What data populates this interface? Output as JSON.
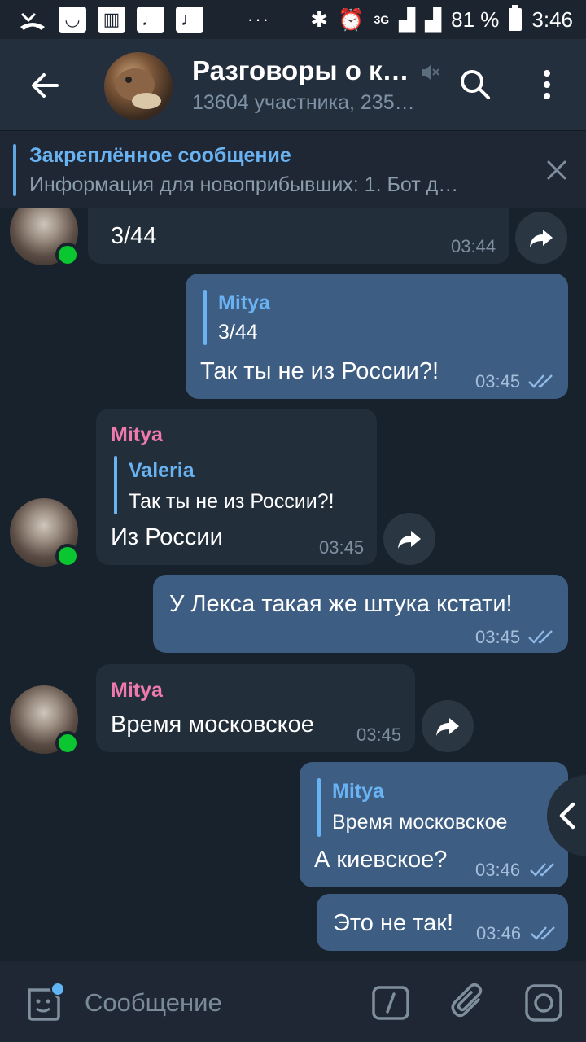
{
  "status_bar": {
    "signal_label": "3G",
    "battery": "81 %",
    "time": "3:46"
  },
  "header": {
    "title": "Разговоры о к…",
    "subtitle": "13604 участника, 235…"
  },
  "pinned": {
    "title": "Закреплённое сообщение",
    "text": "Информация для новоприбывших:  1. Бот д…"
  },
  "messages": [
    {
      "dir": "in",
      "text": "3/44",
      "time": "03:44"
    },
    {
      "dir": "out",
      "reply_name": "Mitya",
      "reply_text": "3/44",
      "text": "Так ты не из России?!",
      "time": "03:45"
    },
    {
      "dir": "in",
      "sender": "Mitya",
      "reply_name": "Valeria",
      "reply_text": "Так ты не из России?!",
      "text": "Из России",
      "time": "03:45"
    },
    {
      "dir": "out",
      "text": "У Лекса такая же штука кстати!",
      "time": "03:45"
    },
    {
      "dir": "in",
      "sender": "Mitya",
      "text": "Время московское",
      "time": "03:45"
    },
    {
      "dir": "out",
      "reply_name": "Mitya",
      "reply_text": "Время московское",
      "text": "А киевское?",
      "time": "03:46"
    },
    {
      "dir": "out",
      "text": "Это не так!",
      "time": "03:46"
    }
  ],
  "composer": {
    "placeholder": "Сообщение"
  },
  "colors": {
    "background": "#18222d",
    "header": "#242f3d",
    "incoming_bubble": "#232e3b",
    "outgoing_bubble": "#3d5d83",
    "accent": "#6ab3f3",
    "sender_name": "#ee7aae",
    "online": "#0ac630"
  }
}
